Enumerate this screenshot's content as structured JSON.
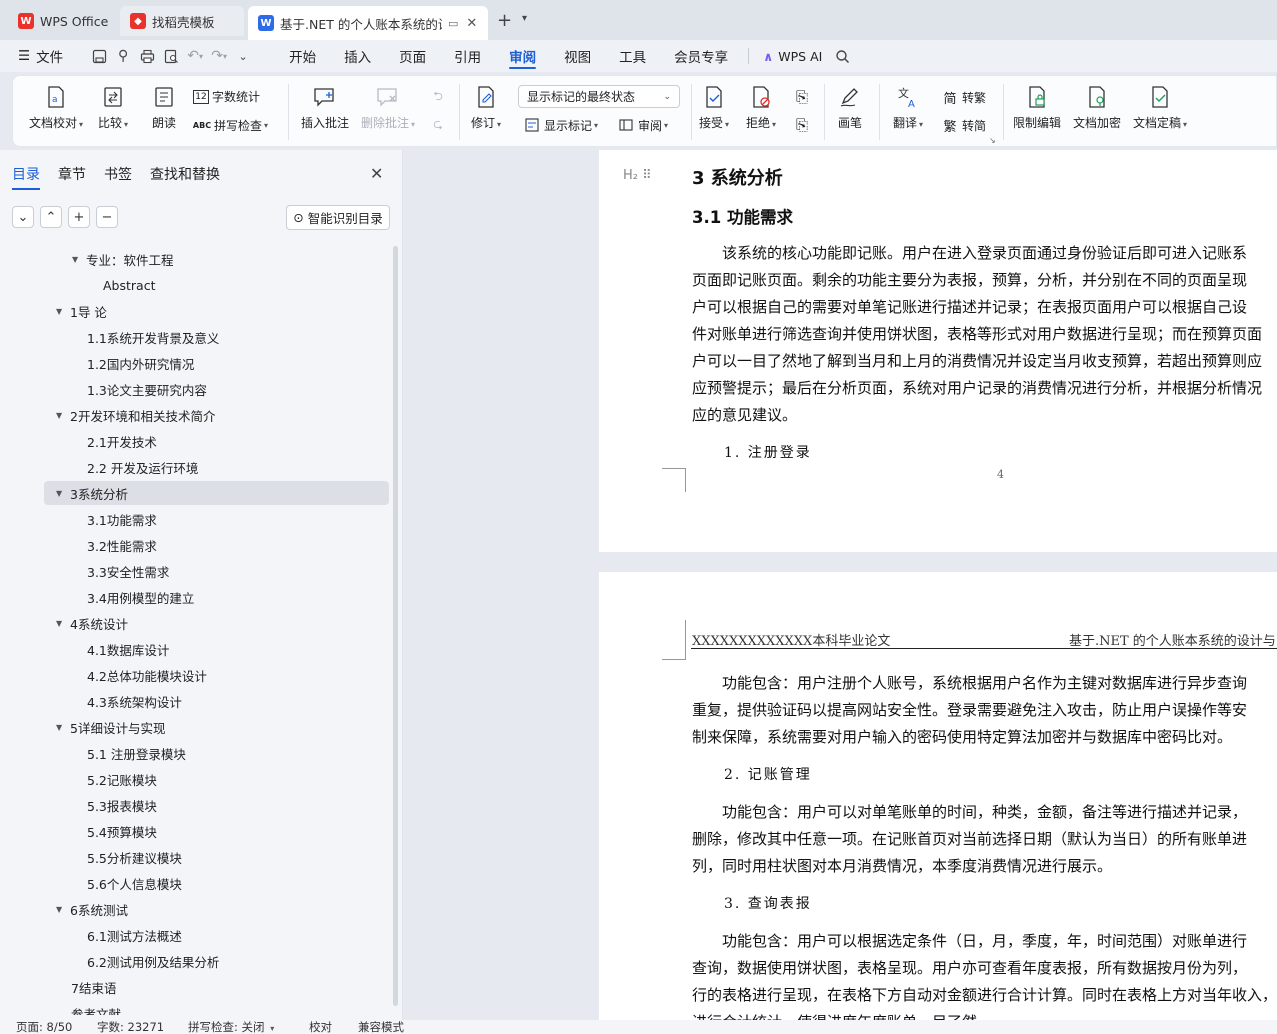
{
  "tabs": [
    {
      "label": "WPS Office",
      "icon": "wps-logo-icon",
      "color": "#e8322b"
    },
    {
      "label": "找稻壳模板",
      "icon": "docer-icon",
      "color": "#e8322b"
    },
    {
      "label": "基于.NET 的个人账本系统的设",
      "icon": "writer-doc-icon",
      "color": "#2e6be6"
    }
  ],
  "menubar": {
    "file": "文件",
    "items": [
      "开始",
      "插入",
      "页面",
      "引用",
      "审阅",
      "视图",
      "工具",
      "会员专享"
    ],
    "active": "审阅",
    "ai": "WPS AI"
  },
  "ribbon": {
    "doc_check": "文档校对",
    "compare": "比较",
    "read_aloud": "朗读",
    "word_count": "字数统计",
    "spell_check": "拼写检查",
    "insert_comment": "插入批注",
    "delete_comment": "删除批注",
    "track": "修订",
    "markup_state": "显示标记的最终状态",
    "show_markup": "显示标记",
    "review": "审阅",
    "accept": "接受",
    "reject": "拒绝",
    "ink": "画笔",
    "translate": "翻译",
    "to_traditional": "转繁",
    "to_simplified": "转简",
    "restrict": "限制编辑",
    "encrypt": "文档加密",
    "finalize": "文档定稿"
  },
  "leftpanel": {
    "tabs": [
      "目录",
      "章节",
      "书签",
      "查找和替换"
    ],
    "smart": "智能识别目录",
    "toc": [
      {
        "text": "专业：软件工程",
        "level": 0,
        "arrow": true
      },
      {
        "text": "Abstract",
        "level": 1,
        "arrow": false
      },
      {
        "text": "1导 论",
        "level": -1,
        "arrow": true
      },
      {
        "text": "1.1系统开发背景及意义",
        "level": 2,
        "arrow": false
      },
      {
        "text": "1.2国内外研究情况",
        "level": 2,
        "arrow": false
      },
      {
        "text": "1.3论文主要研究内容",
        "level": 2,
        "arrow": false
      },
      {
        "text": "2开发环境和相关技术简介",
        "level": -1,
        "arrow": true
      },
      {
        "text": "2.1开发技术",
        "level": 2,
        "arrow": false
      },
      {
        "text": "2.2 开发及运行环境",
        "level": 2,
        "arrow": false
      },
      {
        "text": "3系统分析",
        "level": -1,
        "arrow": true,
        "selected": true
      },
      {
        "text": "3.1功能需求",
        "level": 2,
        "arrow": false
      },
      {
        "text": "3.2性能需求",
        "level": 2,
        "arrow": false
      },
      {
        "text": "3.3安全性需求",
        "level": 2,
        "arrow": false
      },
      {
        "text": "3.4用例模型的建立",
        "level": 2,
        "arrow": false
      },
      {
        "text": "4系统设计",
        "level": -1,
        "arrow": true
      },
      {
        "text": "4.1数据库设计",
        "level": 2,
        "arrow": false
      },
      {
        "text": "4.2总体功能模块设计",
        "level": 2,
        "arrow": false
      },
      {
        "text": "4.3系统架构设计",
        "level": 2,
        "arrow": false
      },
      {
        "text": "5详细设计与实现",
        "level": -1,
        "arrow": true
      },
      {
        "text": "5.1 注册登录模块",
        "level": 2,
        "arrow": false
      },
      {
        "text": "5.2记账模块",
        "level": 2,
        "arrow": false
      },
      {
        "text": "5.3报表模块",
        "level": 2,
        "arrow": false
      },
      {
        "text": "5.4预算模块",
        "level": 2,
        "arrow": false
      },
      {
        "text": "5.5分析建议模块",
        "level": 2,
        "arrow": false
      },
      {
        "text": "5.6个人信息模块",
        "level": 2,
        "arrow": false
      },
      {
        "text": "6系统测试",
        "level": -1,
        "arrow": true
      },
      {
        "text": "6.1测试方法概述",
        "level": 2,
        "arrow": false
      },
      {
        "text": "6.2测试用例及结果分析",
        "level": 2,
        "arrow": false
      },
      {
        "text": "7结束语",
        "level": -1,
        "arrow": false
      },
      {
        "text": "参考文献",
        "level": -1,
        "arrow": false
      }
    ]
  },
  "document": {
    "page1": {
      "h1": "3 系统分析",
      "h2": "3.1 功能需求",
      "para": [
        "　　该系统的核心功能即记账。用户在进入登录页面通过身份验证后即可进入记账系",
        "页面即记账页面。剩余的功能主要分为表报，预算，分析，并分别在不同的页面呈现",
        "户可以根据自己的需要对单笔记账进行描述并记录；在表报页面用户可以根据自己设",
        "件对账单进行筛选查询并使用饼状图，表格等形式对用户数据进行呈现；而在预算页面",
        "户可以一目了然地了解到当月和上月的消费情况并设定当月收支预算，若超出预算则应",
        "应预警提示；最后在分析页面，系统对用户记录的消费情况进行分析，并根据分析情况",
        "应的意见建议。"
      ],
      "sub1": "1. 注册登录",
      "page_no": "4"
    },
    "page2": {
      "header_left": "XXXXXXXXXXXXX本科毕业论文",
      "header_right": "基于.NET 的个人账本系统的设计与",
      "p1": [
        "　　功能包含：用户注册个人账号，系统根据用户名作为主键对数据库进行异步查询",
        "重复，提供验证码以提高网站安全性。登录需要避免注入攻击，防止用户误操作等安",
        "制来保障，系统需要对用户输入的密码使用特定算法加密并与数据库中密码比对。"
      ],
      "sub2": "2. 记账管理",
      "p2": [
        "　　功能包含：用户可以对单笔账单的时间，种类，金额，备注等进行描述并记录，",
        "删除，修改其中任意一项。在记账首页对当前选择日期（默认为当日）的所有账单进",
        "列，同时用柱状图对本月消费情况，本季度消费情况进行展示。"
      ],
      "sub3": "3. 查询表报",
      "p3": [
        "　　功能包含：用户可以根据选定条件（日，月，季度，年，时间范围）对账单进行",
        "查询，数据使用饼状图，表格呈现。用户亦可查看年度表报，所有数据按月份为列，",
        "行的表格进行呈现，在表格下方自动对金额进行合计计算。同时在表格上方对当年收入，",
        "进行合计统计，使得进度年度账单一目了然。"
      ]
    }
  },
  "statusbar": {
    "page": "页面: 8/50",
    "words": "字数: 23271",
    "spell": "拼写检查: 关闭",
    "proof": "校对",
    "compat": "兼容模式"
  }
}
